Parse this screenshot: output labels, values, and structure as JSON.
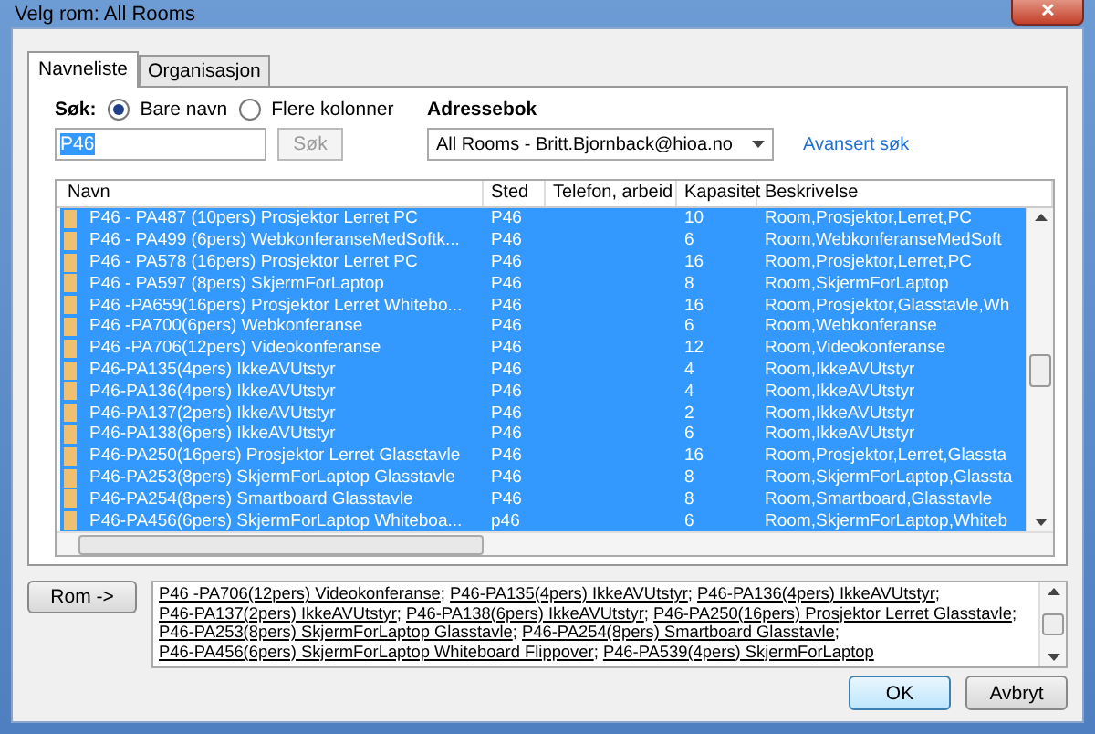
{
  "window": {
    "title": "Velg rom: All Rooms",
    "close": "✕"
  },
  "tabs": [
    {
      "label": "Navneliste",
      "selected": true
    },
    {
      "label": "Organisasjon",
      "selected": false
    }
  ],
  "search": {
    "label": "Søk:",
    "value": "P46",
    "button": "Søk",
    "options": [
      {
        "label": "Bare navn",
        "selected": true
      },
      {
        "label": "Flere kolonner",
        "selected": false
      }
    ]
  },
  "address_book": {
    "label": "Adressebok",
    "value": "All Rooms - Britt.Bjornback@hioa.no",
    "link": "Avansert søk"
  },
  "table": {
    "columns": [
      "Navn",
      "Sted",
      "Telefon, arbeid",
      "Kapasitet",
      "Beskrivelse"
    ],
    "rows": [
      {
        "name": "P46 - PA487 (10pers) Prosjektor Lerret PC",
        "place": "P46",
        "capacity": "10",
        "description": "Room,Prosjektor,Lerret,PC",
        "selected": true
      },
      {
        "name": "P46 - PA499 (6pers) WebkonferanseMedSoftk...",
        "place": "P46",
        "capacity": "6",
        "description": "Room,WebkonferanseMedSoft",
        "selected": true
      },
      {
        "name": "P46 - PA578 (16pers)  Prosjektor Lerret PC",
        "place": "P46",
        "capacity": "16",
        "description": "Room,Prosjektor,Lerret,PC",
        "selected": true
      },
      {
        "name": "P46 - PA597 (8pers) SkjermForLaptop",
        "place": "P46",
        "capacity": "8",
        "description": "Room,SkjermForLaptop",
        "selected": true
      },
      {
        "name": "P46 -PA659(16pers) Prosjektor Lerret Whitebo...",
        "place": "P46",
        "capacity": "16",
        "description": "Room,Prosjektor,Glasstavle,Wh",
        "selected": true
      },
      {
        "name": "P46 -PA700(6pers) Webkonferanse",
        "place": "P46",
        "capacity": "6",
        "description": "Room,Webkonferanse",
        "selected": true
      },
      {
        "name": "P46 -PA706(12pers) Videokonferanse",
        "place": "P46",
        "capacity": "12",
        "description": "Room,Videokonferanse",
        "selected": true
      },
      {
        "name": "P46-PA135(4pers) IkkeAVUtstyr",
        "place": "P46",
        "capacity": "4",
        "description": "Room,IkkeAVUtstyr",
        "selected": true
      },
      {
        "name": "P46-PA136(4pers) IkkeAVUtstyr",
        "place": "P46",
        "capacity": "4",
        "description": "Room,IkkeAVUtstyr",
        "selected": true
      },
      {
        "name": "P46-PA137(2pers) IkkeAVUtstyr",
        "place": "P46",
        "capacity": "2",
        "description": "Room,IkkeAVUtstyr",
        "selected": true
      },
      {
        "name": "P46-PA138(6pers) IkkeAVUtstyr",
        "place": "P46",
        "capacity": "6",
        "description": "Room,IkkeAVUtstyr",
        "selected": true
      },
      {
        "name": "P46-PA250(16pers) Prosjektor Lerret Glasstavle",
        "place": "P46",
        "capacity": "16",
        "description": "Room,Prosjektor,Lerret,Glassta",
        "selected": true
      },
      {
        "name": "P46-PA253(8pers)  SkjermForLaptop Glasstavle",
        "place": "P46",
        "capacity": "8",
        "description": "Room,SkjermForLaptop,Glassta",
        "selected": true
      },
      {
        "name": "P46-PA254(8pers) Smartboard Glasstavle",
        "place": "P46",
        "capacity": "8",
        "description": "Room,Smartboard,Glasstavle",
        "selected": true
      },
      {
        "name": "P46-PA456(6pers) SkjermForLaptop Whiteboa...",
        "place": "p46",
        "capacity": "6",
        "description": "Room,SkjermForLaptop,Whiteb",
        "selected": true
      }
    ]
  },
  "recipients": {
    "button": "Rom ->",
    "separator": ";",
    "items": [
      "P46 -PA706(12pers) Videokonferanse",
      "P46-PA135(4pers) IkkeAVUtstyr",
      "P46-PA136(4pers) IkkeAVUtstyr",
      "P46-PA137(2pers) IkkeAVUtstyr",
      "P46-PA138(6pers) IkkeAVUtstyr",
      "P46-PA250(16pers) Prosjektor Lerret Glasstavle",
      "P46-PA253(8pers)  SkjermForLaptop Glasstavle",
      "P46-PA254(8pers) Smartboard Glasstavle",
      "P46-PA456(6pers) SkjermForLaptop Whiteboard Flippover",
      "P46-PA539(4pers) SkjermForLaptop"
    ]
  },
  "buttons": [
    "OK",
    "Avbryt"
  ]
}
